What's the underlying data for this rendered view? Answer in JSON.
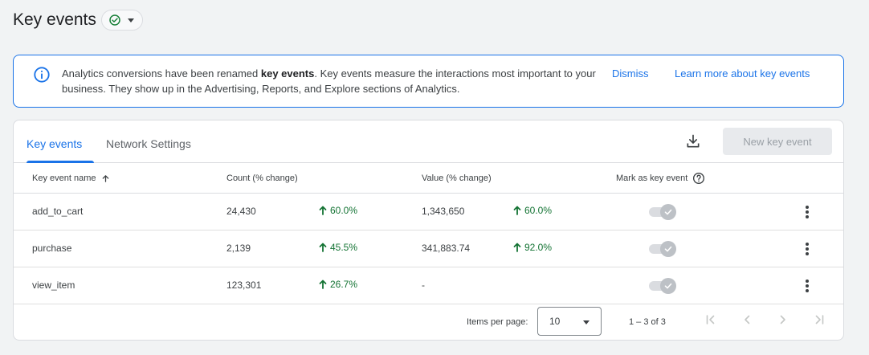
{
  "page": {
    "title": "Key events"
  },
  "banner": {
    "text_before": "Analytics conversions have been renamed ",
    "text_bold": "key events",
    "text_after": ". Key events measure the interactions most important to your business. They show up in the Advertising, Reports, and Explore sections of Analytics.",
    "dismiss_label": "Dismiss",
    "learn_more_label": "Learn more about key events"
  },
  "tabs": [
    {
      "label": "Key events",
      "active": true
    },
    {
      "label": "Network Settings",
      "active": false
    }
  ],
  "toolbar": {
    "new_button_label": "New key event"
  },
  "table": {
    "headers": {
      "name": "Key event name",
      "count": "Count (% change)",
      "value": "Value (% change)",
      "mark": "Mark as key event"
    },
    "rows": [
      {
        "name": "add_to_cart",
        "count": "24,430",
        "count_change": "60.0%",
        "value": "1,343,650",
        "value_change": "60.0%"
      },
      {
        "name": "purchase",
        "count": "2,139",
        "count_change": "45.5%",
        "value": "341,883.74",
        "value_change": "92.0%"
      },
      {
        "name": "view_item",
        "count": "123,301",
        "count_change": "26.7%",
        "value": "-",
        "value_change": ""
      }
    ]
  },
  "pagination": {
    "items_per_page_label": "Items per page:",
    "items_per_page_value": "10",
    "range_text": "1 – 3 of 3"
  },
  "colors": {
    "accent": "#1a73e8",
    "positive": "#137333",
    "border": "#dadce0"
  },
  "icons": {
    "status": "check-circle-icon",
    "info": "info-icon",
    "download": "download-icon",
    "sort": "arrow-up-icon",
    "help": "help-icon",
    "trend": "arrow-up-icon",
    "more": "more-vert-icon"
  }
}
